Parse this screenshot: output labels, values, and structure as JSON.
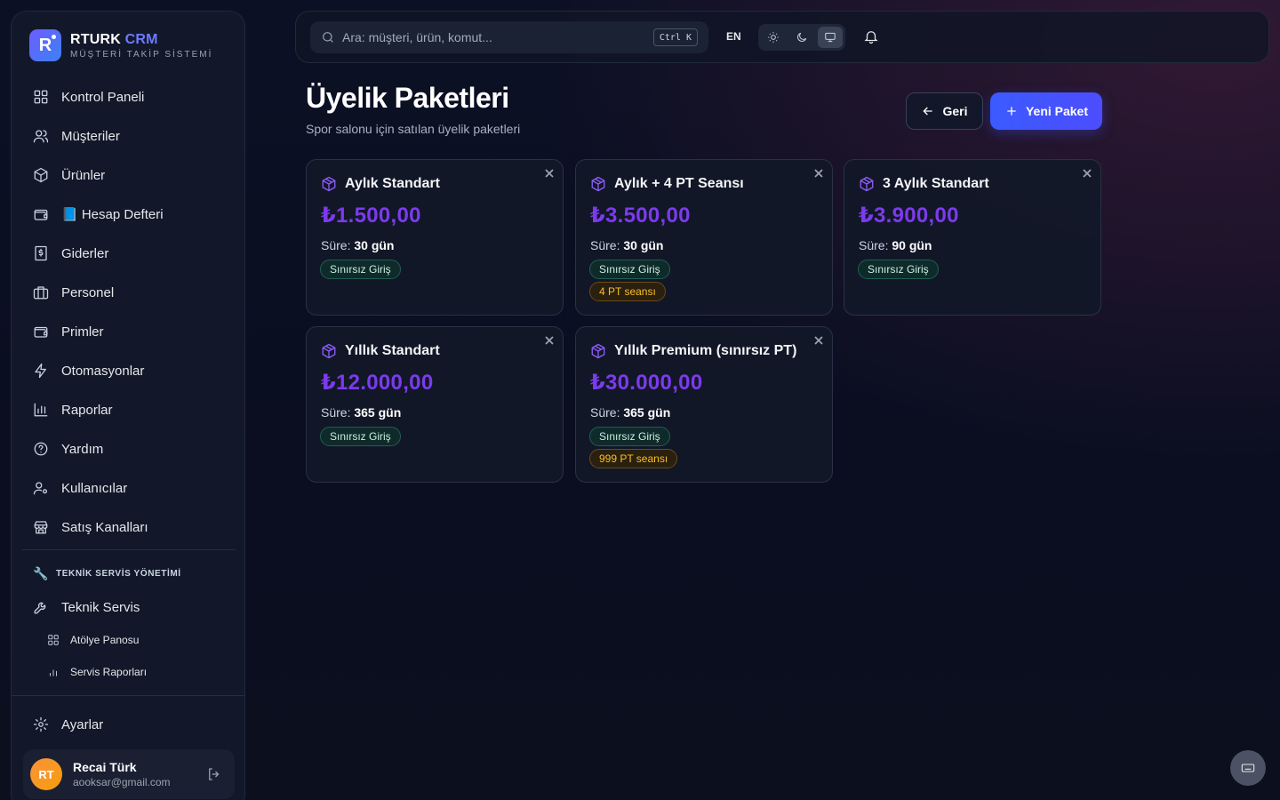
{
  "brand": {
    "name_main": "RTURK",
    "name_accent": "CRM",
    "subtitle": "MÜŞTERİ TAKİP SİSTEMİ",
    "logo_letter": "R"
  },
  "sidebar": {
    "items": [
      {
        "label": "Kontrol Paneli",
        "icon": "dashboard-icon"
      },
      {
        "label": "Müşteriler",
        "icon": "users-icon"
      },
      {
        "label": "Ürünler",
        "icon": "box-icon"
      },
      {
        "label": "📘 Hesap Defteri",
        "icon": "wallet-icon"
      },
      {
        "label": "Giderler",
        "icon": "receipt-icon"
      },
      {
        "label": "Personel",
        "icon": "briefcase-icon"
      },
      {
        "label": "Primler",
        "icon": "wallet-icon"
      },
      {
        "label": "Otomasyonlar",
        "icon": "zap-icon"
      },
      {
        "label": "Raporlar",
        "icon": "bar-chart-icon"
      },
      {
        "label": "Yardım",
        "icon": "help-icon"
      },
      {
        "label": "Kullanıcılar",
        "icon": "user-cog-icon"
      },
      {
        "label": "Satış Kanalları",
        "icon": "store-icon"
      }
    ],
    "section_title": "TEKNİK SERVİS YÖNETİMİ",
    "service_item": "Teknik Servis",
    "sub_items": [
      "Atölye Panosu",
      "Servis Raporları"
    ],
    "settings": "Ayarlar"
  },
  "user": {
    "initials": "RT",
    "name": "Recai Türk",
    "email": "aooksar@gmail.com"
  },
  "topbar": {
    "search_placeholder": "Ara: müşteri, ürün, komut...",
    "shortcut": "Ctrl K",
    "language": "EN",
    "theme_active": "system"
  },
  "header": {
    "title": "Üyelik Paketleri",
    "subtitle": "Spor salonu için satılan üyelik paketleri",
    "back_label": "Geri",
    "new_label": "Yeni Paket"
  },
  "duration_prefix": "Süre:",
  "packages": [
    {
      "name": "Aylık Standart",
      "price": "₺1.500,00",
      "duration": "30 gün",
      "access": "Sınırsız Giriş",
      "pt": ""
    },
    {
      "name": "Aylık + 4 PT Seansı",
      "price": "₺3.500,00",
      "duration": "30 gün",
      "access": "Sınırsız Giriş",
      "pt": "4 PT seansı"
    },
    {
      "name": "3 Aylık Standart",
      "price": "₺3.900,00",
      "duration": "90 gün",
      "access": "Sınırsız Giriş",
      "pt": ""
    },
    {
      "name": "Yıllık Standart",
      "price": "₺12.000,00",
      "duration": "365 gün",
      "access": "Sınırsız Giriş",
      "pt": ""
    },
    {
      "name": "Yıllık Premium (sınırsız PT)",
      "price": "₺30.000,00",
      "duration": "365 gün",
      "access": "Sınırsız Giriş",
      "pt": "999 PT seansı"
    }
  ],
  "colors": {
    "accent": "#4c4dff",
    "price": "#7c3aed",
    "badge_green": "#c7f0de",
    "badge_amber": "#fbbf24"
  }
}
